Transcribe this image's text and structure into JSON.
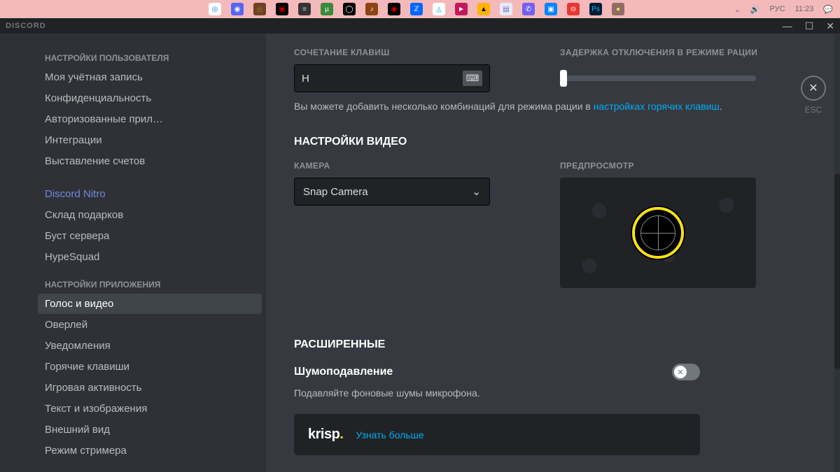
{
  "taskbar": {
    "icons": [
      {
        "bg": "#fff",
        "glyph": "◎",
        "fg": "#1a73e8"
      },
      {
        "bg": "#5865f2",
        "glyph": "◉",
        "fg": "#fff"
      },
      {
        "bg": "#6b4226",
        "glyph": "▦",
        "fg": "#8b5a2b"
      },
      {
        "bg": "#000",
        "glyph": "▣",
        "fg": "#c00"
      },
      {
        "bg": "#333",
        "glyph": "≡",
        "fg": "#ccc"
      },
      {
        "bg": "#3a8a3a",
        "glyph": "µ",
        "fg": "#fff"
      },
      {
        "bg": "#000",
        "glyph": "◯",
        "fg": "#fff"
      },
      {
        "bg": "#8b4513",
        "glyph": "♪",
        "fg": "#fff"
      },
      {
        "bg": "#000",
        "glyph": "◉",
        "fg": "#d00"
      },
      {
        "bg": "#0066ff",
        "glyph": "ℤ",
        "fg": "#fff"
      },
      {
        "bg": "#fff",
        "glyph": "◬",
        "fg": "#00bcd4"
      },
      {
        "bg": "#c2185b",
        "glyph": "►",
        "fg": "#fff"
      },
      {
        "bg": "#ffb300",
        "glyph": "▲",
        "fg": "#000"
      },
      {
        "bg": "#e8eaf6",
        "glyph": "▤",
        "fg": "#5c6bc0"
      },
      {
        "bg": "#7360f2",
        "glyph": "✆",
        "fg": "#fff"
      },
      {
        "bg": "#0084ff",
        "glyph": "▣",
        "fg": "#fff"
      },
      {
        "bg": "#e53935",
        "glyph": "⊝",
        "fg": "#fff"
      },
      {
        "bg": "#001e36",
        "glyph": "Ps",
        "fg": "#31a8ff"
      },
      {
        "bg": "#8d6e63",
        "glyph": "●",
        "fg": "#ffd54f"
      }
    ],
    "right": {
      "lang": "РУС",
      "time": "11:23"
    }
  },
  "titlebar": {
    "title": "DISCORD"
  },
  "sidebar": {
    "user_header": "НАСТРОЙКИ ПОЛЬЗОВАТЕЛЯ",
    "user_items": [
      "Моя учётная запись",
      "Конфиденциальность",
      "Авторизованные прил…",
      "Интеграции",
      "Выставление счетов"
    ],
    "nitro_label": "Discord Nitro",
    "nitro_items": [
      "Склад подарков",
      "Буст сервера",
      "HypeSquad"
    ],
    "app_header": "НАСТРОЙКИ ПРИЛОЖЕНИЯ",
    "app_items": [
      "Голос и видео",
      "Оверлей",
      "Уведомления",
      "Горячие клавиши",
      "Игровая активность",
      "Текст и изображения",
      "Внешний вид",
      "Режим стримера"
    ]
  },
  "content": {
    "esc_label": "ESC",
    "keybind_label": "СОЧЕТАНИЕ КЛАВИШ",
    "keybind_value": "Н",
    "delay_label": "ЗАДЕРЖКА ОТКЛЮЧЕНИЯ В РЕЖИМЕ РАЦИИ",
    "hint_pre": "Вы можете добавить несколько комбинаций для режима рации в ",
    "hint_link": "настройках горячих клавиш",
    "hint_post": ".",
    "video_header": "НАСТРОЙКИ ВИДЕО",
    "camera_label": "КАМЕРА",
    "camera_value": "Snap Camera",
    "preview_label": "ПРЕДПРОСМОТР",
    "advanced_header": "РАСШИРЕННЫЕ",
    "noise_title": "Шумоподавление",
    "noise_desc": "Подавляйте фоновые шумы микрофона.",
    "krisp_logo": "krisp",
    "krisp_link": "Узнать больше"
  }
}
